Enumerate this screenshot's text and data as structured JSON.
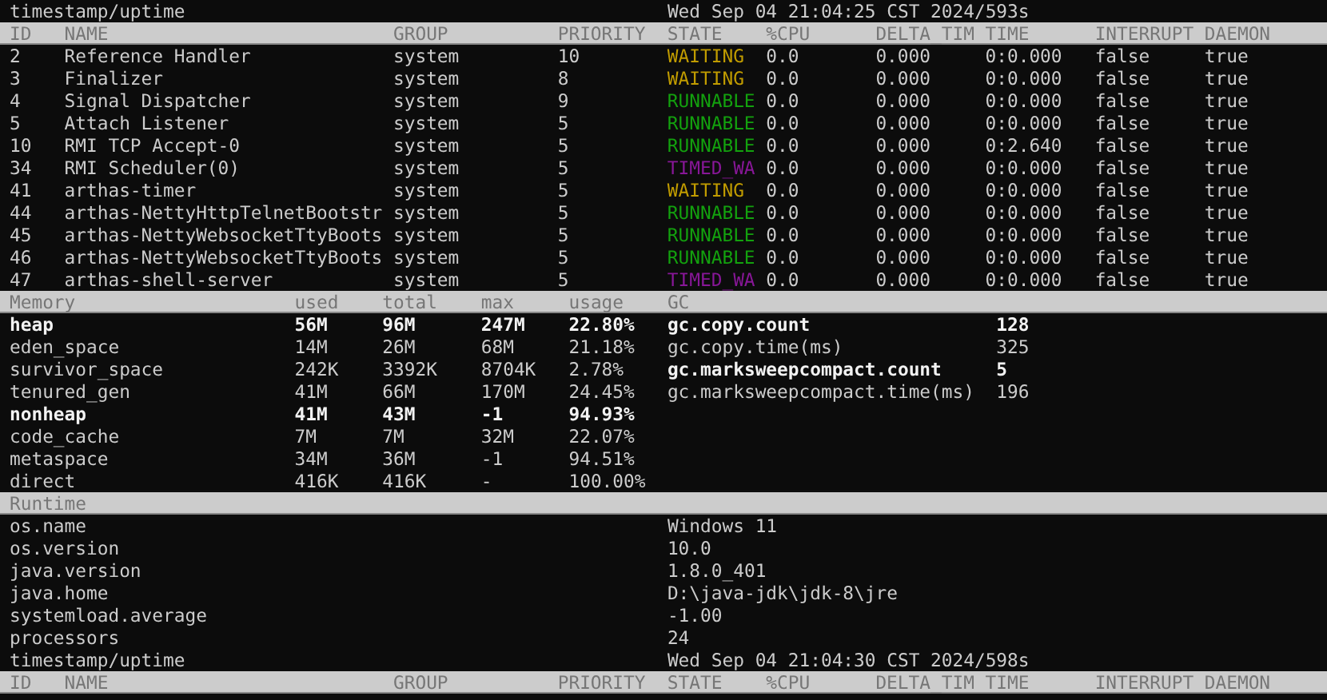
{
  "previous_refresh_tail": {
    "key": "timestamp/uptime",
    "value": "Wed Sep 04 21:04:25 CST 2024/593s"
  },
  "threads": {
    "columns": [
      "ID",
      "NAME",
      "GROUP",
      "PRIORITY",
      "STATE",
      "%CPU",
      "DELTA_TIM",
      "TIME",
      "INTERRUPT",
      "DAEMON"
    ],
    "rows": [
      {
        "id": "2",
        "name": "Reference Handler",
        "group": "system",
        "priority": "10",
        "state": "WAITING",
        "color": "#c19c00",
        "cpu": "0.0",
        "delta_time": "0.000",
        "time": "0:0.000",
        "interrupt": "false",
        "daemon": "true"
      },
      {
        "id": "3",
        "name": "Finalizer",
        "group": "system",
        "priority": "8",
        "state": "WAITING",
        "color": "#c19c00",
        "cpu": "0.0",
        "delta_time": "0.000",
        "time": "0:0.000",
        "interrupt": "false",
        "daemon": "true"
      },
      {
        "id": "4",
        "name": "Signal Dispatcher",
        "group": "system",
        "priority": "9",
        "state": "RUNNABLE",
        "color": "#13a10e",
        "cpu": "0.0",
        "delta_time": "0.000",
        "time": "0:0.000",
        "interrupt": "false",
        "daemon": "true"
      },
      {
        "id": "5",
        "name": "Attach Listener",
        "group": "system",
        "priority": "5",
        "state": "RUNNABLE",
        "color": "#13a10e",
        "cpu": "0.0",
        "delta_time": "0.000",
        "time": "0:0.000",
        "interrupt": "false",
        "daemon": "true"
      },
      {
        "id": "10",
        "name": "RMI TCP Accept-0",
        "group": "system",
        "priority": "5",
        "state": "RUNNABLE",
        "color": "#13a10e",
        "cpu": "0.0",
        "delta_time": "0.000",
        "time": "0:2.640",
        "interrupt": "false",
        "daemon": "true"
      },
      {
        "id": "34",
        "name": "RMI Scheduler(0)",
        "group": "system",
        "priority": "5",
        "state": "TIMED_WA",
        "color": "#881798",
        "cpu": "0.0",
        "delta_time": "0.000",
        "time": "0:0.000",
        "interrupt": "false",
        "daemon": "true"
      },
      {
        "id": "41",
        "name": "arthas-timer",
        "group": "system",
        "priority": "5",
        "state": "WAITING",
        "color": "#c19c00",
        "cpu": "0.0",
        "delta_time": "0.000",
        "time": "0:0.000",
        "interrupt": "false",
        "daemon": "true"
      },
      {
        "id": "44",
        "name": "arthas-NettyHttpTelnetBootstr",
        "group": "system",
        "priority": "5",
        "state": "RUNNABLE",
        "color": "#13a10e",
        "cpu": "0.0",
        "delta_time": "0.000",
        "time": "0:0.000",
        "interrupt": "false",
        "daemon": "true"
      },
      {
        "id": "45",
        "name": "arthas-NettyWebsocketTtyBoots",
        "group": "system",
        "priority": "5",
        "state": "RUNNABLE",
        "color": "#13a10e",
        "cpu": "0.0",
        "delta_time": "0.000",
        "time": "0:0.000",
        "interrupt": "false",
        "daemon": "true"
      },
      {
        "id": "46",
        "name": "arthas-NettyWebsocketTtyBoots",
        "group": "system",
        "priority": "5",
        "state": "RUNNABLE",
        "color": "#13a10e",
        "cpu": "0.0",
        "delta_time": "0.000",
        "time": "0:0.000",
        "interrupt": "false",
        "daemon": "true"
      },
      {
        "id": "47",
        "name": "arthas-shell-server",
        "group": "system",
        "priority": "5",
        "state": "TIMED_WA",
        "color": "#881798",
        "cpu": "0.0",
        "delta_time": "0.000",
        "time": "0:0.000",
        "interrupt": "false",
        "daemon": "true"
      }
    ]
  },
  "memory": {
    "columns": [
      "Memory",
      "used",
      "total",
      "max",
      "usage"
    ],
    "rows": [
      {
        "name": "heap",
        "used": "56M",
        "total": "96M",
        "max": "247M",
        "usage": "22.80%",
        "emphasis": true
      },
      {
        "name": "eden_space",
        "used": "14M",
        "total": "26M",
        "max": "68M",
        "usage": "21.18%",
        "emphasis": false
      },
      {
        "name": "survivor_space",
        "used": "242K",
        "total": "3392K",
        "max": "8704K",
        "usage": "2.78%",
        "emphasis": false
      },
      {
        "name": "tenured_gen",
        "used": "41M",
        "total": "66M",
        "max": "170M",
        "usage": "24.45%",
        "emphasis": false
      },
      {
        "name": "nonheap",
        "used": "41M",
        "total": "43M",
        "max": "-1",
        "usage": "94.93%",
        "emphasis": true
      },
      {
        "name": "code_cache",
        "used": "7M",
        "total": "7M",
        "max": "32M",
        "usage": "22.07%",
        "emphasis": false
      },
      {
        "name": "metaspace",
        "used": "34M",
        "total": "36M",
        "max": "-1",
        "usage": "94.51%",
        "emphasis": false
      },
      {
        "name": "direct",
        "used": "416K",
        "total": "416K",
        "max": "-",
        "usage": "100.00%",
        "emphasis": false
      }
    ]
  },
  "gc": {
    "title": "GC",
    "rows": [
      {
        "key": "gc.copy.count",
        "value": "128",
        "emphasis": true
      },
      {
        "key": "gc.copy.time(ms)",
        "value": "325",
        "emphasis": false
      },
      {
        "key": "gc.marksweepcompact.count",
        "value": "5",
        "emphasis": true
      },
      {
        "key": "gc.marksweepcompact.time(ms)",
        "value": "196",
        "emphasis": false
      }
    ]
  },
  "runtime": {
    "title": "Runtime",
    "rows": [
      {
        "key": "os.name",
        "value": "Windows 11"
      },
      {
        "key": "os.version",
        "value": "10.0"
      },
      {
        "key": "java.version",
        "value": "1.8.0_401"
      },
      {
        "key": "java.home",
        "value": "D:\\java-jdk\\jdk-8\\jre"
      },
      {
        "key": "systemload.average",
        "value": "-1.00"
      },
      {
        "key": "processors",
        "value": "24"
      },
      {
        "key": "timestamp/uptime",
        "value": "Wed Sep 04 21:04:30 CST 2024/598s"
      }
    ]
  },
  "next_refresh_header": {
    "columns": [
      "ID",
      "NAME",
      "GROUP",
      "PRIORITY",
      "STATE",
      "%CPU",
      "DELTA_TIM",
      "TIME",
      "INTERRUPT",
      "DAEMON"
    ]
  }
}
